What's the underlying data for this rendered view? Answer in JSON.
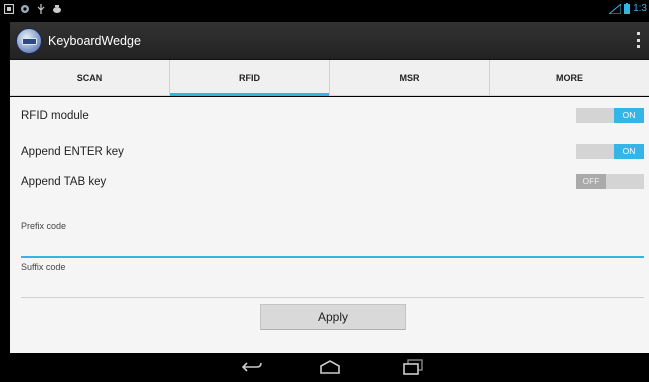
{
  "status_bar": {
    "clock": "1:3",
    "icons": [
      "notification-icon",
      "settings-notif-icon",
      "usb-icon",
      "debug-icon",
      "signal-icon",
      "battery-icon"
    ]
  },
  "app": {
    "title": "KeyboardWedge",
    "icon": "keyboard-app-icon"
  },
  "tabs": [
    {
      "label": "SCAN",
      "active": false
    },
    {
      "label": "RFID",
      "active": true
    },
    {
      "label": "MSR",
      "active": false
    },
    {
      "label": "MORE",
      "active": false
    }
  ],
  "settings": {
    "rfid_module": {
      "label": "RFID module",
      "state": "ON"
    },
    "append_enter": {
      "label": "Append ENTER key",
      "state": "ON"
    },
    "append_tab": {
      "label": "Append TAB key",
      "state": "OFF"
    }
  },
  "fields": {
    "prefix": {
      "label": "Prefix code",
      "value": "",
      "placeholder": ""
    },
    "suffix": {
      "label": "Suffix code",
      "value": "",
      "placeholder": ""
    }
  },
  "apply_label": "Apply",
  "colors": {
    "accent": "#33b5e5",
    "action_bar": "#2b2b2b",
    "content_bg": "#f5f5f5"
  },
  "nav": [
    "back-icon",
    "home-icon",
    "recents-icon"
  ]
}
